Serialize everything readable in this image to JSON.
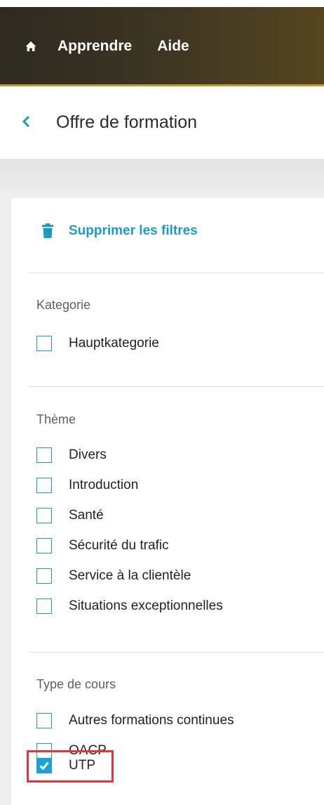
{
  "nav": {
    "home_icon": "home-icon",
    "links": [
      "Apprendre",
      "Aide"
    ]
  },
  "header": {
    "back_icon": "chevron-left-icon",
    "title": "Offre de formation"
  },
  "filters": {
    "clear_icon": "trash-icon",
    "clear_label": "Supprimer les filtres",
    "sections": [
      {
        "title": "Kategorie",
        "options": [
          {
            "label": "Hauptkategorie",
            "checked": false
          }
        ]
      },
      {
        "title": "Thème",
        "options": [
          {
            "label": "Divers",
            "checked": false
          },
          {
            "label": "Introduction",
            "checked": false
          },
          {
            "label": "Santé",
            "checked": false
          },
          {
            "label": "Sécurité du trafic",
            "checked": false
          },
          {
            "label": "Service à la clientèle",
            "checked": false
          },
          {
            "label": "Situations exceptionnelles",
            "checked": false
          }
        ]
      },
      {
        "title": "Type de cours",
        "options": [
          {
            "label": "Autres formations continues",
            "checked": false
          },
          {
            "label": "OACP",
            "checked": false
          },
          {
            "label": "UTP",
            "checked": true
          }
        ]
      }
    ]
  },
  "colors": {
    "accent": "#1a9bc4",
    "header_dark": "#2e2a20",
    "header_gold": "#55461f",
    "highlight": "#e0353a"
  }
}
